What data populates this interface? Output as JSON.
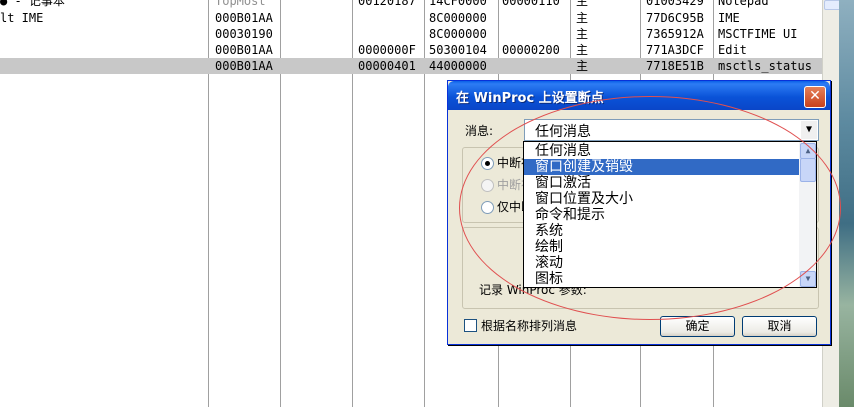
{
  "grid": {
    "rows": [
      {
        "c0": "● - 记事本",
        "c1": "TopMost",
        "c3": "00120187",
        "c4": "14CF0000",
        "c5": "00000110",
        "c6": "主",
        "c7": "01003429",
        "c8": "Notepad"
      },
      {
        "c0": "lt IME",
        "c1": "000B01AA",
        "c3": "",
        "c4": "8C000000",
        "c5": "",
        "c6": "主",
        "c7": "77D6C95B",
        "c8": "IME"
      },
      {
        "c0": "",
        "c1": "00030190",
        "c3": "",
        "c4": "8C000000",
        "c5": "",
        "c6": "主",
        "c7": "7365912A",
        "c8": "MSCTFIME UI"
      },
      {
        "c0": "",
        "c1": "000B01AA",
        "c3": "0000000F",
        "c4": "50300104",
        "c5": "00000200",
        "c6": "主",
        "c7": "771A3DCF",
        "c8": "Edit"
      },
      {
        "c0": "",
        "c1": "000B01AA",
        "c3": "00000401",
        "c4": "44000000",
        "c5": "",
        "c6": "主",
        "c7": "7718E51B",
        "c8": "msctls_status"
      }
    ]
  },
  "dialog": {
    "title": "在 WinProc 上设置断点",
    "close_glyph": "✕",
    "message_label": "消息:",
    "combo_value": "任何消息",
    "combo_arrow": "▼",
    "radio1_label": "中断在",
    "radio2_label": "中断在",
    "radio3_label": "仅中断",
    "record_label": "记录 WinProc 参数:",
    "sort_checkbox_label": "根据名称排列消息",
    "ok_label": "确定",
    "cancel_label": "取消"
  },
  "dropdown": {
    "options": [
      "任何消息",
      "窗口创建及销毁",
      "窗口激活",
      "窗口位置及大小",
      "命令和提示",
      "系统",
      "绘制",
      "滚动",
      "图标"
    ],
    "highlighted_index": 1,
    "scroll_up_glyph": "▲",
    "scroll_down_glyph": "▼"
  },
  "colors": {
    "selection": "#316ac5",
    "title_bar": "#0a53d8",
    "annotation": "#e05050"
  }
}
